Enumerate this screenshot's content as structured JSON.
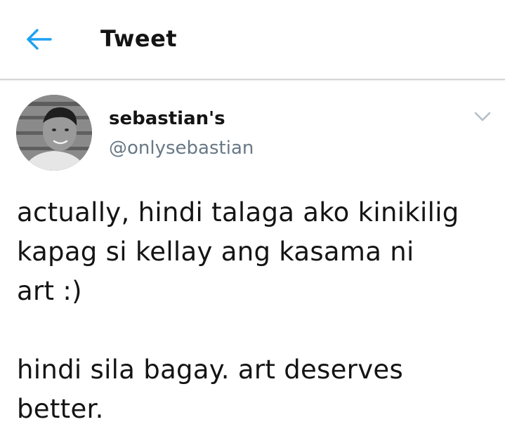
{
  "header": {
    "title": "Tweet",
    "back_icon": "back-arrow-icon"
  },
  "tweet": {
    "author": {
      "display_name": "sebastian's",
      "handle": "@onlysebastian"
    },
    "menu_icon": "chevron-down-icon",
    "text": "actually, hindi talaga ako kinikilig\nkapag si kellay ang kasama ni\nart :)\n\nhindi sila bagay. art deserves\nbetter."
  },
  "colors": {
    "accent": "#1da1f2",
    "handle": "#687886",
    "divider": "#d4d6d8",
    "text": "#141414"
  }
}
